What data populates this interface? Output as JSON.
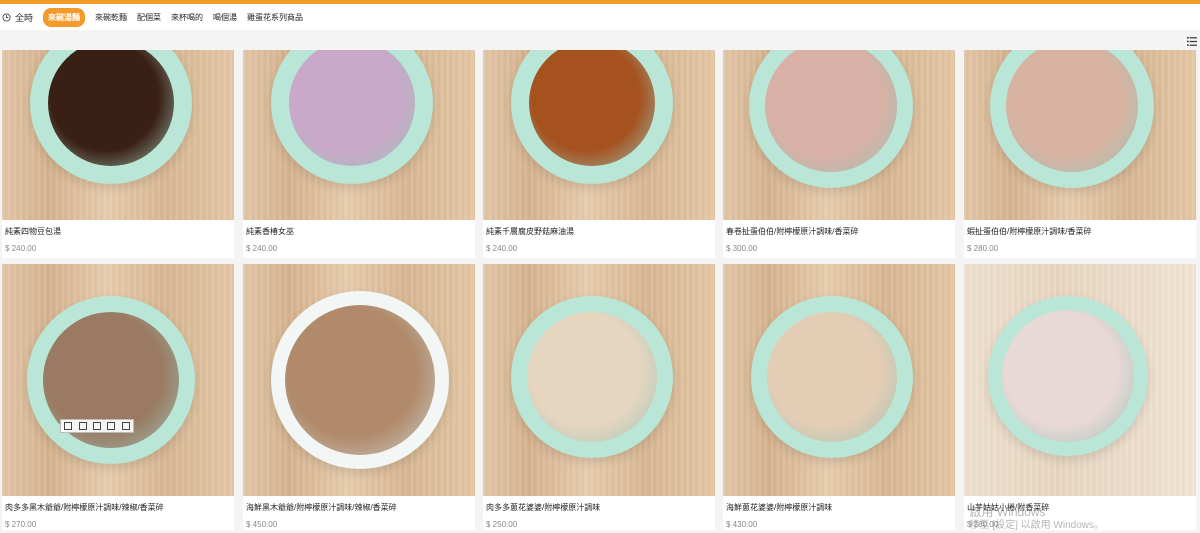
{
  "time_filter": {
    "label": "全時"
  },
  "nav": {
    "items": [
      {
        "label": "來碗湯麵",
        "active": true
      },
      {
        "label": "來碗乾麵",
        "active": false
      },
      {
        "label": "配個菜",
        "active": false
      },
      {
        "label": "來杯喝的",
        "active": false
      },
      {
        "label": "喝個湯",
        "active": false
      },
      {
        "label": "雞蛋花系列商品",
        "active": false
      }
    ]
  },
  "colors": {
    "accent": "#f39a2b",
    "bowl": "#b9e6d6"
  },
  "products": [
    {
      "name": "純素四物豆包湯",
      "price": "$ 240.00",
      "soup": "#3a1f14"
    },
    {
      "name": "純素香椿女巫",
      "price": "$ 240.00",
      "soup": "#c9a8c9"
    },
    {
      "name": "純素千層腐皮野菇麻油湯",
      "price": "$ 240.00",
      "soup": "#a5521f"
    },
    {
      "name": "春卷扯蛋伯伯/附檸檬原汁調味/香菜碎",
      "price": "$ 300.00",
      "soup": "#d9b0a5"
    },
    {
      "name": "蝦扯蛋伯伯/附檸檬原汁調味/香菜碎",
      "price": "$ 280.00",
      "soup": "#d8b3a2"
    },
    {
      "name": "肉多多黑木爺爺/附檸檬原汁調味/辣椒/香菜碎",
      "price": "$ 270.00",
      "soup": "#9a7a62"
    },
    {
      "name": "海鮮黑木爺爺/附檸檬原汁調味/辣椒/香菜碎",
      "price": "$ 450.00",
      "soup": "#b08a6a"
    },
    {
      "name": "肉多多蔥花婆婆/附檸檬原汁調味",
      "price": "$ 250.00",
      "soup": "#e6d6c0"
    },
    {
      "name": "海鮮蔥花婆婆/附檸檬原汁調味",
      "price": "$ 430.00",
      "soup": "#e4cdb5"
    },
    {
      "name": "山芋姑姑小捲/附香菜碎",
      "price": "$ 280.00",
      "soup": "#e8d8d6"
    }
  ],
  "watermark": {
    "line1": "啟用 Windows",
    "line2": "移至 [設定] 以啟用 Windows。"
  }
}
